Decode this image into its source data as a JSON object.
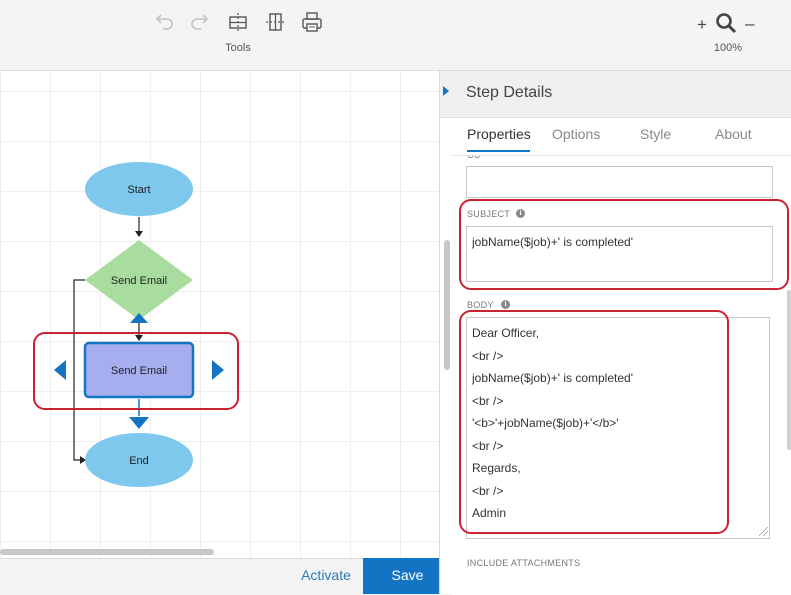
{
  "toolbar": {
    "tools_label": "Tools",
    "zoom_in": "+",
    "zoom_out": "–",
    "zoom_level": "100%",
    "icons": [
      "undo-icon",
      "redo-icon",
      "split-horizontal-icon",
      "split-vertical-icon",
      "print-icon",
      "zoom-magnifier-icon"
    ]
  },
  "workflow": {
    "nodes": [
      {
        "label": "Start",
        "shape": "ellipse",
        "color": "#7dc8ec"
      },
      {
        "label": "Send Email",
        "shape": "diamond",
        "color": "#a9dda0"
      },
      {
        "label": "Send Email",
        "shape": "rectangle",
        "color": "#a6aef0",
        "selected": true
      },
      {
        "label": "End",
        "shape": "ellipse",
        "color": "#7dc8ec"
      }
    ],
    "accent_color": "#1474c4"
  },
  "bottom_bar": {
    "activate_label": "Activate",
    "save_label": "Save"
  },
  "panel": {
    "title": "Step Details",
    "tabs": [
      {
        "label": "Properties",
        "active": true
      },
      {
        "label": "Options",
        "active": false
      },
      {
        "label": "Style",
        "active": false
      },
      {
        "label": "About",
        "active": false
      }
    ],
    "cc_label_partial": "CC",
    "cc_value": "",
    "subject_label": "SUBJECT",
    "subject_value": "jobName($job)+' is completed'",
    "body_label": "BODY",
    "body_lines": [
      "Dear Officer,",
      "<br />",
      "jobName($job)+' is completed'",
      "<br />",
      "'<b>'+jobName($job)+'</b>'",
      "<br />",
      "Regards,",
      "<br />",
      "Admin"
    ],
    "include_attachments_label": "INCLUDE ATTACHMENTS"
  },
  "colors": {
    "highlight": "#cc2230",
    "primary_button": "#1474c4"
  }
}
